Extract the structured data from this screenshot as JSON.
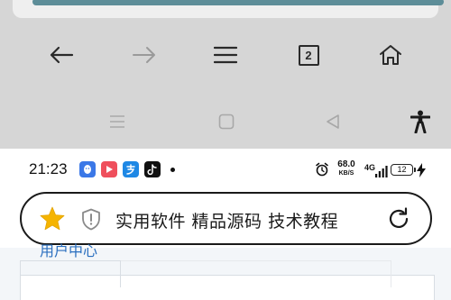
{
  "browser_toolbar": {
    "tab_count": "2"
  },
  "status_bar": {
    "time": "21:23",
    "net_speed": "68.0",
    "net_speed_unit": "KB/S",
    "network_type": "4G",
    "battery": "12"
  },
  "address_bar": {
    "title": "实用软件 精品源码 技术教程"
  },
  "page": {
    "partial_link": "用户中心"
  },
  "colors": {
    "dimmed_background": "#d6d6d6",
    "star": "#f5b400",
    "link": "#2a6fbf"
  }
}
